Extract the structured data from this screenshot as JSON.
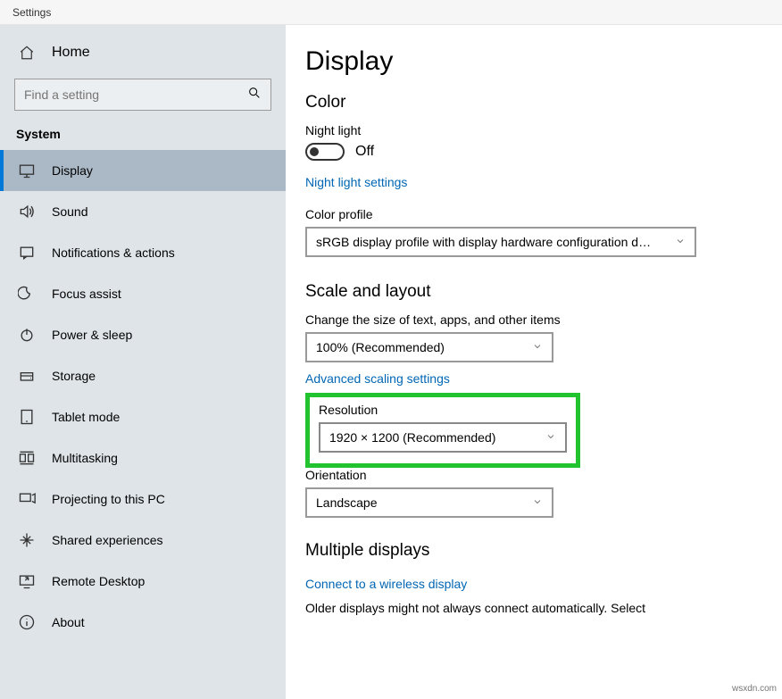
{
  "window": {
    "title": "Settings"
  },
  "sidebar": {
    "home": "Home",
    "search_placeholder": "Find a setting",
    "category": "System",
    "items": [
      {
        "label": "Display",
        "selected": true
      },
      {
        "label": "Sound"
      },
      {
        "label": "Notifications & actions"
      },
      {
        "label": "Focus assist"
      },
      {
        "label": "Power & sleep"
      },
      {
        "label": "Storage"
      },
      {
        "label": "Tablet mode"
      },
      {
        "label": "Multitasking"
      },
      {
        "label": "Projecting to this PC"
      },
      {
        "label": "Shared experiences"
      },
      {
        "label": "Remote Desktop"
      },
      {
        "label": "About"
      }
    ]
  },
  "main": {
    "title": "Display",
    "color_heading": "Color",
    "night_light_label": "Night light",
    "night_light_state": "Off",
    "night_light_link": "Night light settings",
    "color_profile_label": "Color profile",
    "color_profile_value": "sRGB display profile with display hardware configuration d…",
    "scale_heading": "Scale and layout",
    "scale_label": "Change the size of text, apps, and other items",
    "scale_value": "100% (Recommended)",
    "adv_scaling_link": "Advanced scaling settings",
    "resolution_label": "Resolution",
    "resolution_value": "1920 × 1200 (Recommended)",
    "orientation_label": "Orientation",
    "orientation_value": "Landscape",
    "multi_heading": "Multiple displays",
    "wireless_link": "Connect to a wireless display",
    "older_text": "Older displays might not always connect automatically. Select"
  },
  "watermark": "wsxdn.com"
}
